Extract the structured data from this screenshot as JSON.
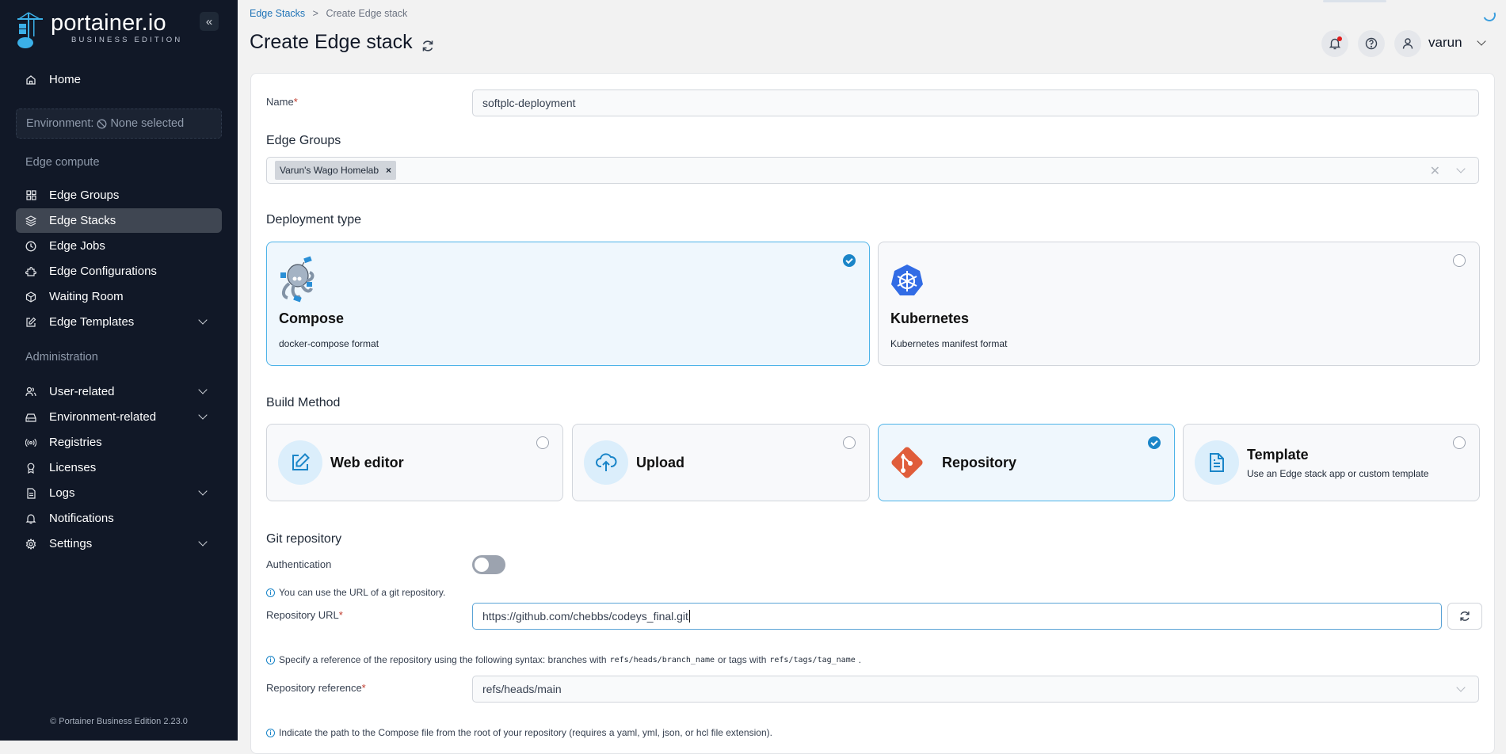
{
  "app": {
    "logo_name": "portainer.io",
    "logo_edition": "BUSINESS EDITION",
    "version_footer": "Portainer Business Edition 2.23.0"
  },
  "sidebar": {
    "home": "Home",
    "environment": {
      "label": "Environment:",
      "value": "None selected"
    },
    "sections": [
      {
        "title": "Edge compute",
        "items": [
          {
            "label": "Edge Groups",
            "icon": "grid-icon"
          },
          {
            "label": "Edge Stacks",
            "icon": "layers-icon",
            "active": true
          },
          {
            "label": "Edge Jobs",
            "icon": "clock-icon"
          },
          {
            "label": "Edge Configurations",
            "icon": "puzzle-icon"
          },
          {
            "label": "Waiting Room",
            "icon": "box-icon"
          },
          {
            "label": "Edge Templates",
            "icon": "edit-icon",
            "expandable": true
          }
        ]
      },
      {
        "title": "Administration",
        "items": [
          {
            "label": "User-related",
            "icon": "users-icon",
            "expandable": true
          },
          {
            "label": "Environment-related",
            "icon": "hard-drive-icon",
            "expandable": true
          },
          {
            "label": "Registries",
            "icon": "radio-icon"
          },
          {
            "label": "Licenses",
            "icon": "award-icon"
          },
          {
            "label": "Logs",
            "icon": "file-text-icon",
            "expandable": true
          },
          {
            "label": "Notifications",
            "icon": "bell-icon"
          },
          {
            "label": "Settings",
            "icon": "settings-icon",
            "expandable": true
          }
        ]
      }
    ]
  },
  "header": {
    "breadcrumb": {
      "parent": "Edge Stacks",
      "separator": ">",
      "current": "Create Edge stack"
    },
    "title": "Create Edge stack",
    "user": "varun"
  },
  "form": {
    "name": {
      "label": "Name",
      "required": "*",
      "value": "softplc-deployment"
    },
    "edge_groups": {
      "label": "Edge Groups",
      "selected": [
        "Varun's Wago Homelab"
      ]
    },
    "deployment_type": {
      "label": "Deployment type",
      "options": [
        {
          "title": "Compose",
          "desc": "docker-compose format",
          "selected": true
        },
        {
          "title": "Kubernetes",
          "desc": "Kubernetes manifest format",
          "selected": false
        }
      ]
    },
    "build_method": {
      "label": "Build Method",
      "options": [
        {
          "title": "Web editor",
          "desc": "",
          "selected": false
        },
        {
          "title": "Upload",
          "desc": "",
          "selected": false
        },
        {
          "title": "Repository",
          "desc": "",
          "selected": true
        },
        {
          "title": "Template",
          "desc": "Use an Edge stack app or custom template",
          "selected": false
        }
      ]
    },
    "git": {
      "section": "Git repository",
      "auth_label": "Authentication",
      "auth_enabled": false,
      "url_info": "You can use the URL of a git repository.",
      "url_label": "Repository URL",
      "url_value": "https://github.com/chebbs/codeys_final.git",
      "ref_info_pre": "Specify a reference of the repository using the following syntax: branches with",
      "ref_info_code1": "refs/heads/branch_name",
      "ref_info_mid": "or tags with",
      "ref_info_code2": "refs/tags/tag_name",
      "ref_info_post": ".",
      "ref_label": "Repository reference",
      "ref_value": "refs/heads/main",
      "path_info": "Indicate the path to the Compose file from the root of your repository (requires a yaml, yml, json, or hcl file extension)."
    }
  },
  "colors": {
    "sidebar_bg": "#111827",
    "accent": "#1a85c8",
    "selected_border": "#4db3e8",
    "git_orange": "#e05d3a",
    "k8s_blue": "#326ce5"
  }
}
